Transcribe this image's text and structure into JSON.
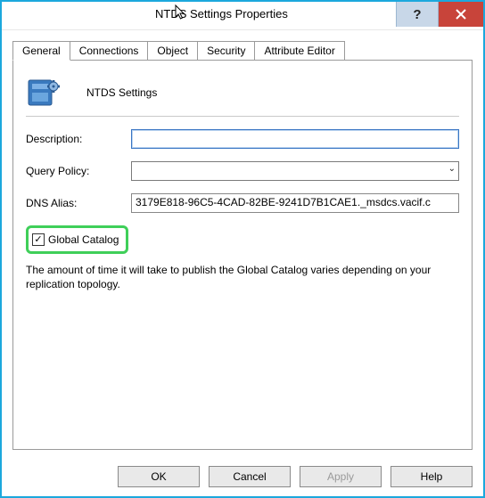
{
  "window": {
    "title": "NTDS Settings Properties"
  },
  "tabs": {
    "items": [
      {
        "label": "General",
        "active": true
      },
      {
        "label": "Connections",
        "active": false
      },
      {
        "label": "Object",
        "active": false
      },
      {
        "label": "Security",
        "active": false
      },
      {
        "label": "Attribute Editor",
        "active": false
      }
    ]
  },
  "general": {
    "header": "NTDS Settings",
    "description_label": "Description:",
    "description_value": "",
    "query_policy_label": "Query Policy:",
    "query_policy_value": "",
    "dns_alias_label": "DNS Alias:",
    "dns_alias_value": "3179E818-96C5-4CAD-82BE-9241D7B1CAE1._msdcs.vacif.c",
    "global_catalog_label": "Global Catalog",
    "global_catalog_checked": true,
    "info_text": "The amount of time it will take to publish the Global Catalog varies depending on your replication topology."
  },
  "buttons": {
    "ok": "OK",
    "cancel": "Cancel",
    "apply": "Apply",
    "help": "Help"
  }
}
